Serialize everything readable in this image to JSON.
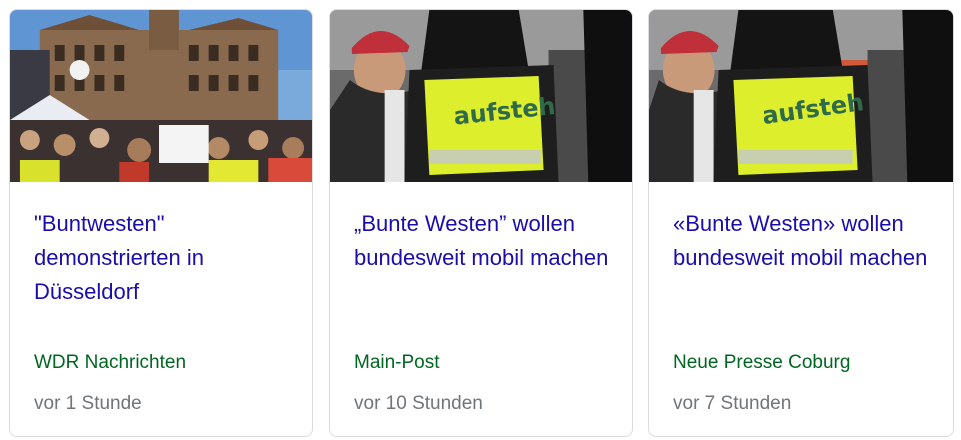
{
  "cards": [
    {
      "image": "news-thumbnail-demonstration-duesseldorf",
      "headline": "\"Buntwesten\" demonstrierten in Düsseldorf",
      "source": "WDR Nachrichten",
      "time": "vor 1 Stunde"
    },
    {
      "image": "news-thumbnail-yellow-vest-aufstehen",
      "headline": "„Bunte Westen” wollen bundesweit mobil machen",
      "source": "Main-Post",
      "time": "vor 10 Stunden"
    },
    {
      "image": "news-thumbnail-yellow-vest-aufstehen",
      "headline": "«Bunte Westen» wollen bundesweit mobil machen",
      "source": "Neue Presse Coburg",
      "time": "vor 7 Stunden"
    }
  ],
  "vest_text": "aufsteh",
  "colors": {
    "headline": "#1a0dab",
    "source": "#006621",
    "time": "#70757a",
    "border": "#dadce0"
  }
}
